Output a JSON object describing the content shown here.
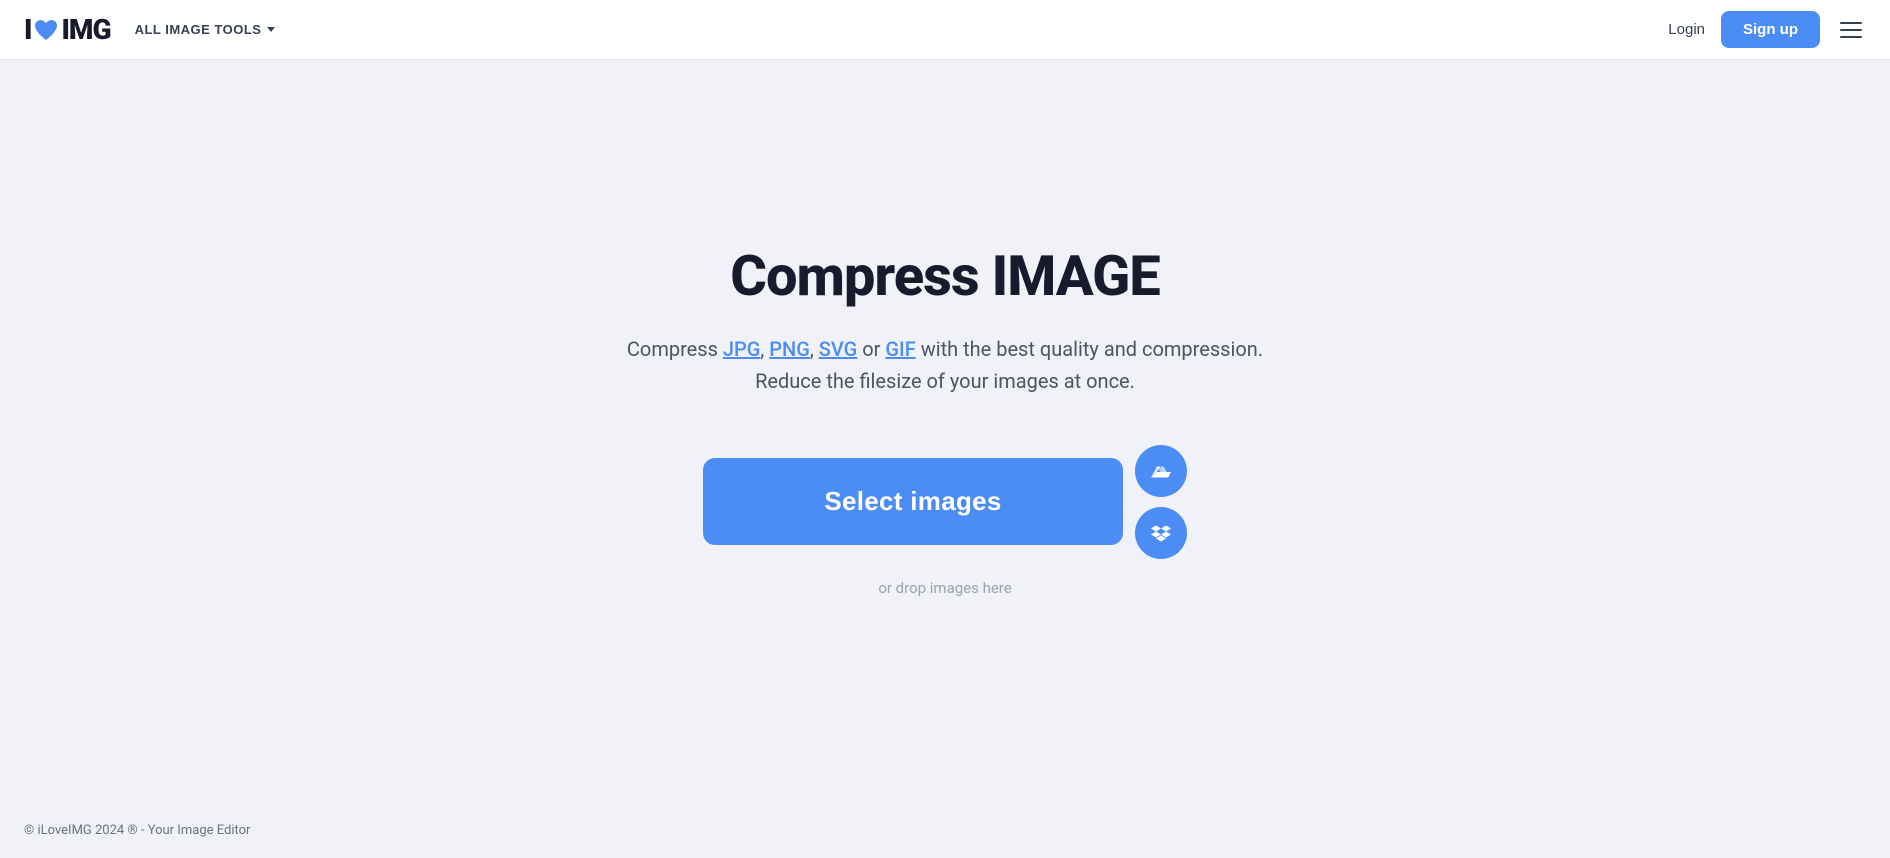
{
  "logo": {
    "i_text": "I",
    "img_text": "IMG"
  },
  "navbar": {
    "tools_label": "ALL IMAGE TOOLS",
    "login_label": "Login",
    "signup_label": "Sign up"
  },
  "page": {
    "title": "Compress IMAGE",
    "subtitle_prefix": "Compress ",
    "subtitle_formats": [
      "JPG",
      "PNG",
      "SVG",
      "GIF"
    ],
    "subtitle_suffix": " with the best quality and compression.",
    "subtitle_line2": "Reduce the filesize of your images at once.",
    "select_button_label": "Select images",
    "drop_text": "or drop images here"
  },
  "footer": {
    "text": "© iLoveIMG 2024 ® - Your Image Editor"
  }
}
